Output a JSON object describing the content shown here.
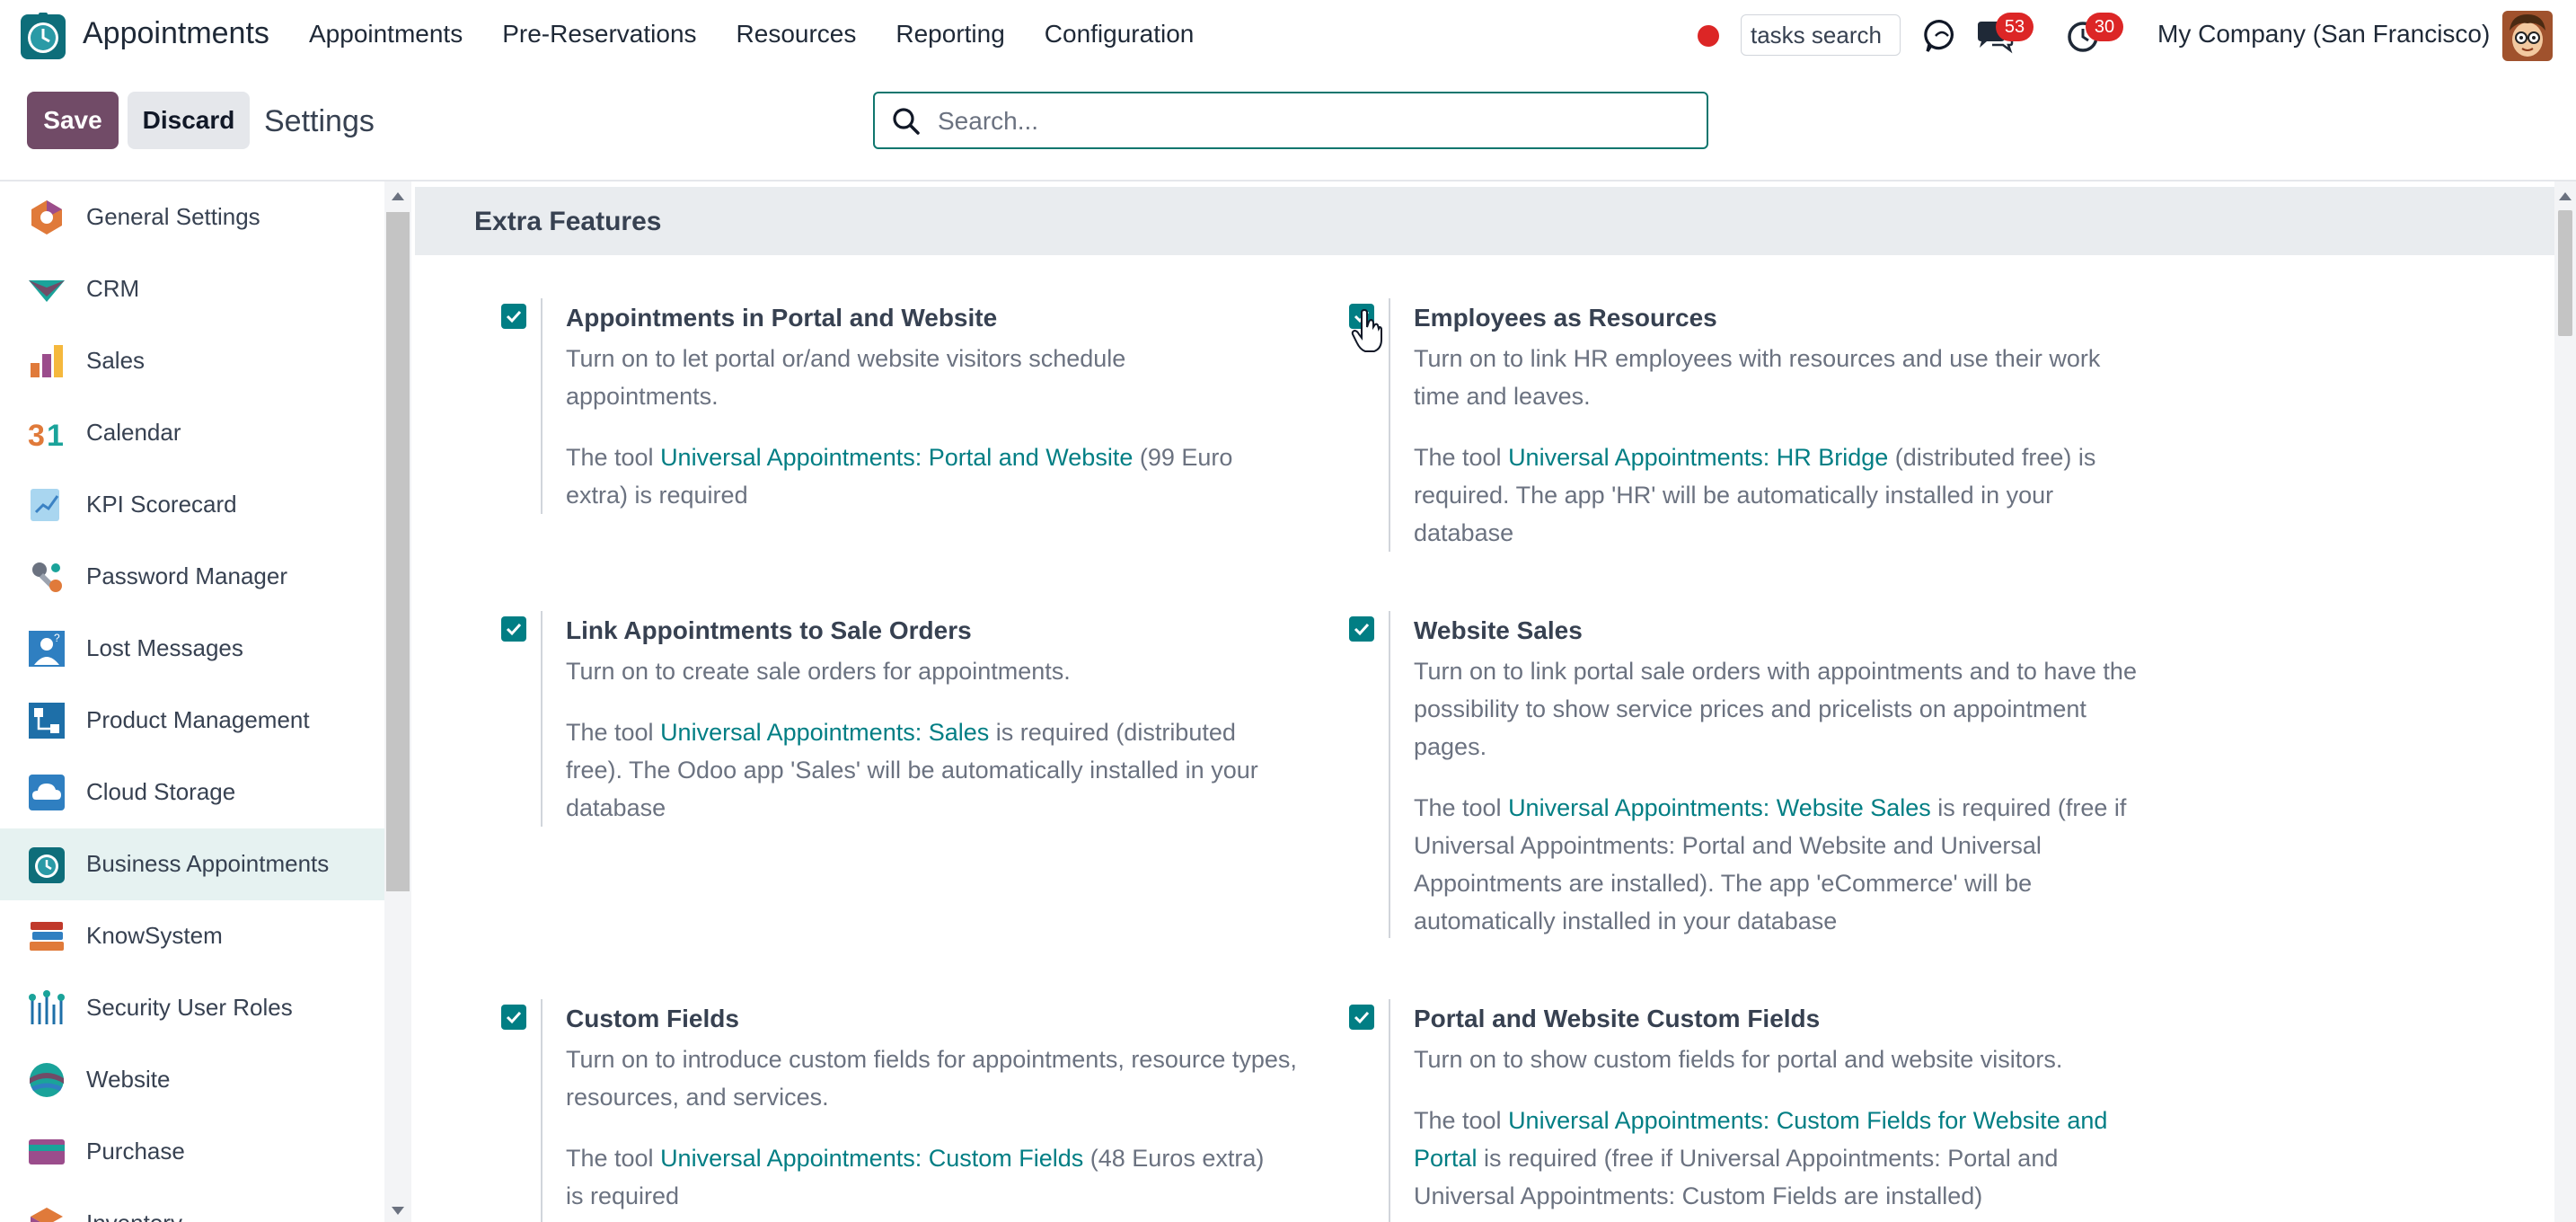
{
  "navbar": {
    "app_title": "Appointments",
    "menu": [
      "Appointments",
      "Pre-Reservations",
      "Resources",
      "Reporting",
      "Configuration"
    ],
    "tasks_search_value": "tasks search",
    "messages_count": "53",
    "activities_count": "30",
    "company": "My Company (San Francisco)"
  },
  "control_panel": {
    "save_label": "Save",
    "discard_label": "Discard",
    "title": "Settings",
    "search_placeholder": "Search..."
  },
  "sidebar": {
    "items": [
      {
        "label": "General Settings",
        "icon": "general-settings-icon"
      },
      {
        "label": "CRM",
        "icon": "crm-icon"
      },
      {
        "label": "Sales",
        "icon": "sales-icon"
      },
      {
        "label": "Calendar",
        "icon": "calendar-icon"
      },
      {
        "label": "KPI Scorecard",
        "icon": "kpi-scorecard-icon"
      },
      {
        "label": "Password Manager",
        "icon": "password-manager-icon"
      },
      {
        "label": "Lost Messages",
        "icon": "lost-messages-icon"
      },
      {
        "label": "Product Management",
        "icon": "product-management-icon"
      },
      {
        "label": "Cloud Storage",
        "icon": "cloud-storage-icon"
      },
      {
        "label": "Business Appointments",
        "icon": "business-appointments-icon",
        "active": true
      },
      {
        "label": "KnowSystem",
        "icon": "knowsystem-icon"
      },
      {
        "label": "Security User Roles",
        "icon": "security-user-roles-icon"
      },
      {
        "label": "Website",
        "icon": "website-icon"
      },
      {
        "label": "Purchase",
        "icon": "purchase-icon"
      },
      {
        "label": "Inventory",
        "icon": "inventory-icon"
      }
    ]
  },
  "main": {
    "section_title": "Extra Features",
    "settings": [
      {
        "title": "Appointments in Portal and Website",
        "description": "Turn on to let portal or/and website visitors schedule appointments.",
        "note_prefix": "The tool ",
        "note_link": "Universal Appointments: Portal and Website",
        "note_suffix": " (99 Euro extra) is required",
        "checked": true
      },
      {
        "title": "Employees as Resources",
        "description": "Turn on to link HR employees with resources and use their work time and leaves.",
        "note_prefix": "The tool ",
        "note_link": "Universal Appointments: HR Bridge",
        "note_suffix": " (distributed free) is required. The app 'HR' will be automatically installed in your database",
        "checked": true
      },
      {
        "title": "Link Appointments to Sale Orders",
        "description": "Turn on to create sale orders for appointments.",
        "note_prefix": "The tool ",
        "note_link": "Universal Appointments: Sales",
        "note_suffix": " is required (distributed free). The Odoo app 'Sales' will be automatically installed in your database",
        "checked": true
      },
      {
        "title": "Website Sales",
        "description": "Turn on to link portal sale orders with appointments and to have the possibility to show service prices and pricelists on appointment pages.",
        "note_prefix": "The tool ",
        "note_link": "Universal Appointments: Website Sales",
        "note_suffix": " is required (free if Universal Appointments: Portal and Website and Universal Appointments are installed). The app 'eCommerce' will be automatically installed in your database",
        "checked": true
      },
      {
        "title": "Custom Fields",
        "description": "Turn on to introduce custom fields for appointments, resource types, resources, and services.",
        "note_prefix": "The tool ",
        "note_link": "Universal Appointments: Custom Fields",
        "note_suffix": " (48 Euros extra) is required",
        "checked": true
      },
      {
        "title": "Portal and Website Custom Fields",
        "description": "Turn on to show custom fields for portal and website visitors.",
        "note_prefix": "The tool ",
        "note_link": "Universal Appointments: Custom Fields for Website and Portal",
        "note_suffix": " is required (free if Universal Appointments: Portal and Universal Appointments: Custom Fields are installed)",
        "checked": true
      }
    ]
  },
  "colors": {
    "brand_primary": "#714b67",
    "accent_teal": "#017e84",
    "badge_red": "#dc2626",
    "active_row": "#e6f2f1"
  }
}
